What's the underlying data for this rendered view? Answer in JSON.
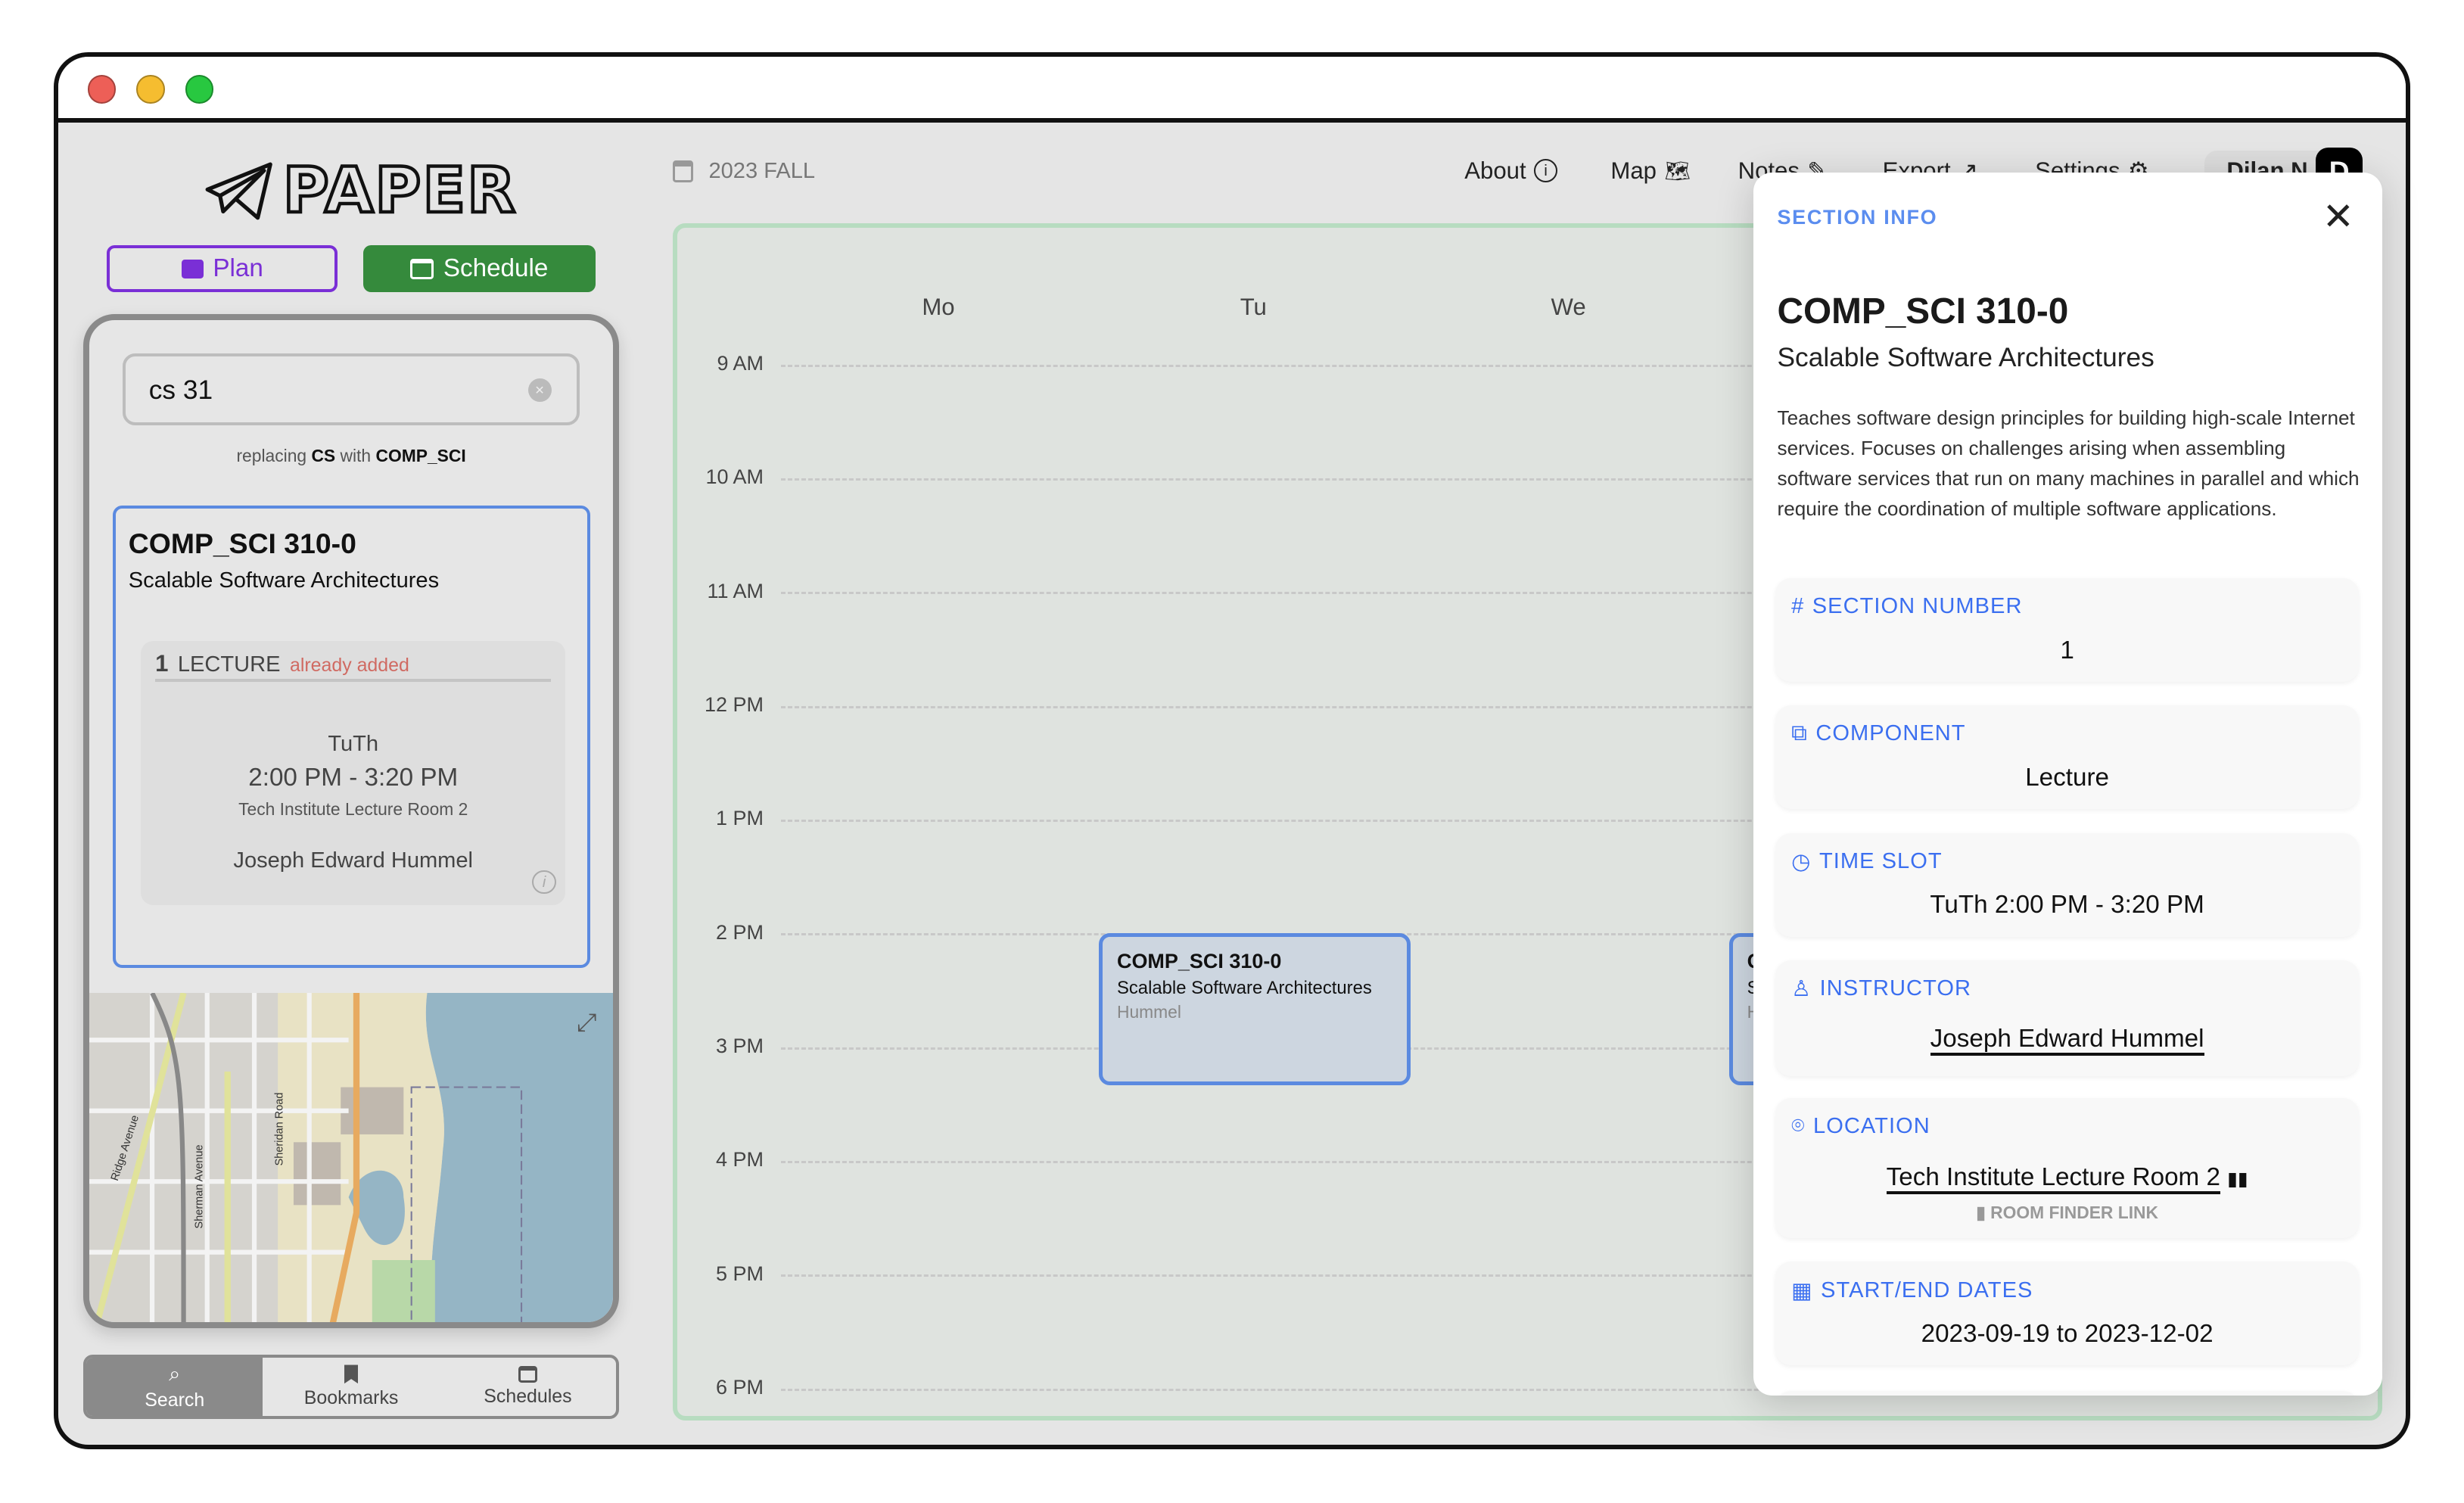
{
  "app": {
    "logo_text": "PAPER"
  },
  "mode_buttons": {
    "plan": "Plan",
    "schedule": "Schedule",
    "plan_color": "#7a2fd6",
    "schedule_color": "#358a3c"
  },
  "search": {
    "value": "cs 31",
    "replacing_prefix": "replacing",
    "replacing_from": "CS",
    "replacing_mid": "with",
    "replacing_to": "COMP_SCI"
  },
  "result": {
    "code": "COMP_SCI 310-0",
    "title": "Scalable Software Architectures",
    "section": {
      "number": "1",
      "component": "LECTURE",
      "status": "already added",
      "days": "TuTh",
      "time": "2:00 PM - 3:20 PM",
      "room": "Tech Institute Lecture Room 2",
      "instructor": "Joseph Edward Hummel"
    }
  },
  "map": {
    "labels": [
      "Ridge Avenue",
      "Sherman Avenue",
      "Sheridan Road"
    ]
  },
  "bottom_tabs": [
    {
      "label": "Search",
      "icon": "search-icon",
      "active": true
    },
    {
      "label": "Bookmarks",
      "icon": "bookmark-icon"
    },
    {
      "label": "Schedules",
      "icon": "calendar-icon"
    }
  ],
  "topbar": {
    "term": "2023 FALL",
    "nav": [
      {
        "label": "About",
        "icon": "info-icon"
      },
      {
        "label": "Map",
        "icon": "map-icon"
      },
      {
        "label": "Notes",
        "icon": "edit-icon"
      },
      {
        "label": "Export",
        "icon": "external-link-icon"
      },
      {
        "label": "Settings",
        "icon": "gear-icon"
      }
    ],
    "user": "Dilan N",
    "avatar_letter": "D"
  },
  "calendar": {
    "days": [
      "Mo",
      "Tu",
      "We"
    ],
    "hours": [
      "9 AM",
      "10 AM",
      "11 AM",
      "12 PM",
      "1 PM",
      "2 PM",
      "3 PM",
      "4 PM",
      "5 PM",
      "6 PM"
    ],
    "events": [
      {
        "code": "COMP_SCI 310-0",
        "title": "Scalable Software Architectures",
        "instructor": "Hummel",
        "day": "Tu",
        "start": "2:00 PM",
        "end": "3:20 PM"
      },
      {
        "code": "COMP_SCI 310-0",
        "title": "Scalable Software Architectures",
        "instructor": "Hummel",
        "day": "Th",
        "start": "2:00 PM",
        "end": "3:20 PM"
      }
    ]
  },
  "section_info": {
    "header": "SECTION INFO",
    "code": "COMP_SCI 310-0",
    "title": "Scalable Software Architectures",
    "description": "Teaches software design principles for building high-scale Internet services. Focuses on challenges arising when assembling software services that run on many machines in parallel and which require the coordination of multiple software applications.",
    "fields": {
      "section_number": {
        "label": "SECTION NUMBER",
        "value": "1"
      },
      "component": {
        "label": "COMPONENT",
        "value": "Lecture"
      },
      "time_slot": {
        "label": "TIME SLOT",
        "value": "TuTh 2:00 PM - 3:20 PM"
      },
      "instructor": {
        "label": "INSTRUCTOR",
        "value": "Joseph Edward Hummel"
      },
      "location": {
        "label": "LOCATION",
        "value": "Tech Institute Lecture Room 2",
        "link": "ROOM FINDER LINK"
      },
      "dates": {
        "label": "START/END DATES",
        "value": "2023-09-19 to 2023-12-02"
      }
    },
    "accent": "#3b6ff0"
  }
}
